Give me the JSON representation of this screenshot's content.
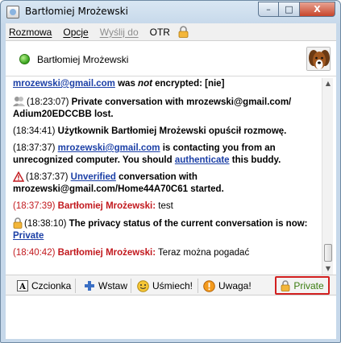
{
  "window": {
    "title": "Bartłomiej Mrożewski",
    "controls": {
      "minimize": "–",
      "maximize": "□",
      "close": "X"
    }
  },
  "menu": {
    "items": [
      "Rozmowa",
      "Opcje",
      "Wyślij do",
      "OTR"
    ]
  },
  "header": {
    "contact_name": "Bartłomiej Mrożewski",
    "status": "online"
  },
  "messages": {
    "m1": {
      "email": "mrozewski@gmail.com",
      "was": " was ",
      "not": "not",
      "rest": " encrypted: [nie]"
    },
    "m2": {
      "ts": "(18:23:07)",
      "text": " Private conversation with mrozewski@gmail.com/ Adium20EDCCBB lost."
    },
    "m3": {
      "ts": "(18:34:41)",
      "text": " Użytkownik Bartłomiej Mrożewski opuścił rozmowę."
    },
    "m4": {
      "ts": "(18:37:37)",
      "email": "mrozewski@gmail.com",
      "text1": " is contacting you from an unrecognized computer.  You should ",
      "link": "authenticate",
      "text2": " this buddy."
    },
    "m5": {
      "ts": "(18:37:37)",
      "link": "Unverified",
      "text": " conversation with mrozewski@gmail.com/Home44A70C61 started."
    },
    "m6": {
      "ts": "(18:37:39)",
      "sender": "Bartłomiej Mrożewski:",
      "text": " test"
    },
    "m7": {
      "ts": "(18:38:10)",
      "text": " The privacy status of the current conversation is now: ",
      "link": "Private"
    },
    "m8": {
      "ts": "(18:40:42)",
      "sender": "Bartłomiej Mrożewski:",
      "text": " Teraz można pogadać"
    }
  },
  "toolbar": {
    "font": "Czcionka",
    "insert": "Wstaw",
    "smile": "Uśmiech!",
    "attention": "Uwaga!",
    "private": "Private"
  },
  "colors": {
    "link": "#1b3fa6",
    "sender": "#c2191e",
    "private_border": "#d21f1f",
    "private_text": "#3b7d10"
  }
}
